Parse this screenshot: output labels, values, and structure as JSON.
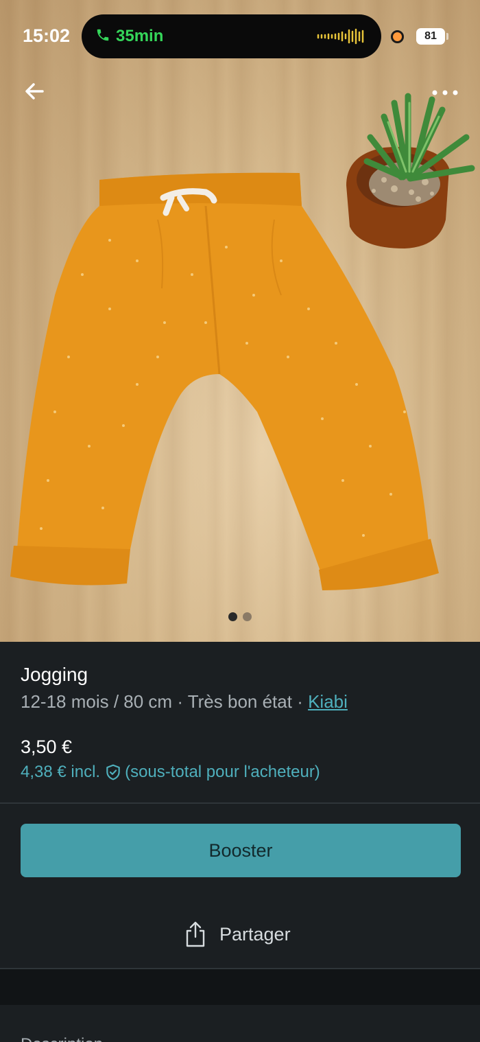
{
  "status_bar": {
    "time": "15:02",
    "call_duration": "35min",
    "battery": "81"
  },
  "listing": {
    "title": "Jogging",
    "size": "12-18 mois / 80 cm",
    "separator": " · ",
    "condition": "Très bon état",
    "brand": "Kiabi",
    "price": "3,50 €",
    "price_incl_amount": "4,38 € incl.",
    "price_incl_note": "(sous-total pour l'acheteur)"
  },
  "actions": {
    "booster_label": "Booster",
    "share_label": "Partager"
  },
  "description": {
    "label": "Description"
  },
  "carousel": {
    "current": 1,
    "total": 2
  },
  "colors": {
    "accent": "#459ea9",
    "link": "#4fb0bd",
    "background": "#1b1f22",
    "call_green": "#35d65a"
  },
  "icons": {
    "back": "arrow-left-icon",
    "more": "more-horizontal-icon",
    "phone": "phone-icon",
    "shield": "shield-check-icon",
    "share": "share-icon"
  }
}
